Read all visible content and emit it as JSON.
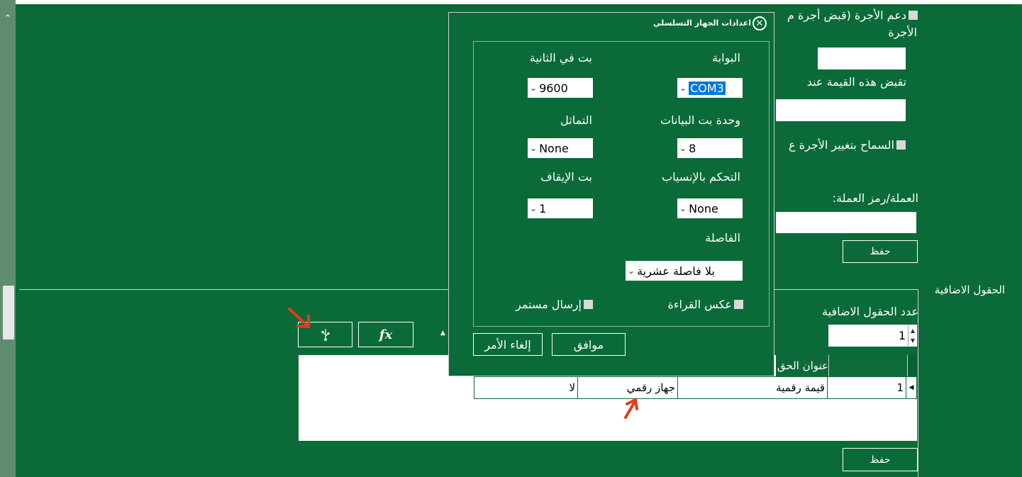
{
  "main": {
    "checkbox_support_wage": "دعم الأجرة (قبض أجرة م",
    "checkbox_support_wage_line2": "الأجرة",
    "collect_value_label": "تقبض هذه القيمة عند",
    "allow_change_wage_label": "السماح بتغيير الأجرة ع",
    "currency_label": "العملة/رمز العملة:",
    "save_label": "حفظ"
  },
  "extra_fields": {
    "group_title": "الحقول الاضافية",
    "count_label": "عدد الحقول الاضافية",
    "count_value": "1",
    "save_label": "حفظ",
    "fx_label": "fx",
    "usb_icon_label": "usb",
    "table": {
      "header": "عنوان الحق",
      "row": {
        "index": "1",
        "title": "قيمة رقمية",
        "source": "جهاز رقمي",
        "flag": "لا"
      }
    }
  },
  "dialog": {
    "title": "اعدادات الجهاز التسلسلي",
    "port_label": "البوابة",
    "port_value": "COM3",
    "baud_label": "بت في الثانية",
    "baud_value": "9600",
    "databits_label": "وحدة بت البيانات",
    "databits_value": "8",
    "parity_label": "التماثل",
    "parity_value": "None",
    "flow_label": "التحكم بالإنسياب",
    "flow_value": "None",
    "stopbits_label": "بت الإيقاف",
    "stopbits_value": "1",
    "decimal_label": "الفاصلة",
    "decimal_value": "بلا فاصلة عشرية",
    "reverse_read_label": "عكس القراءة",
    "continuous_send_label": "إرسال مستمر",
    "ok_label": "موافق",
    "cancel_label": "إلغاء الأمر"
  },
  "colors": {
    "panel_green": "#0a6b38",
    "accent_highlight": "#0078d7",
    "annotation_red": "#e8391a"
  }
}
